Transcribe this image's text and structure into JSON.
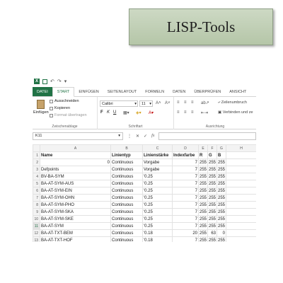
{
  "banner": {
    "title": "LISP-Tools"
  },
  "qat": {
    "app_icon": "X",
    "icons": [
      "excel-logo-icon",
      "save-icon",
      "undo-icon",
      "redo-icon",
      "customize-icon"
    ],
    "undo_glyph": "↶",
    "redo_glyph": "↷",
    "more_glyph": "▾"
  },
  "tabs": [
    "DATEI",
    "START",
    "EINFÜGEN",
    "SEITENLAYOUT",
    "FORMELN",
    "DATEN",
    "ÜBERPRÜFEN",
    "ANSICHT"
  ],
  "active_tab": "START",
  "ribbon": {
    "clipboard": {
      "paste_label": "Einfügen",
      "cut_label": "Ausschneiden",
      "copy_label": "Kopieren",
      "format_painter_label": "Format übertragen",
      "group_label": "Zwischenablage"
    },
    "font": {
      "font_name": "Calibri",
      "font_size": "11",
      "bold": "F",
      "italic": "K",
      "underline": "U",
      "group_label": "Schriftart"
    },
    "alignment": {
      "wrap_text_label": "Zeilenumbruch",
      "merge_label": "Verbinden und ze",
      "group_label": "Ausrichtung"
    }
  },
  "formula_bar": {
    "name_box": "K11",
    "value": ""
  },
  "sheet": {
    "columns": [
      "A",
      "B",
      "C",
      "D",
      "E",
      "F",
      "G",
      "H"
    ],
    "selected_row": 11,
    "rows": [
      {
        "n": "1",
        "cells": [
          "Name",
          "Linientyp",
          "Linienstärke",
          "Indexfarbe",
          "R",
          "G",
          "B",
          ""
        ]
      },
      {
        "n": "2",
        "cells": [
          "0",
          "Continuous",
          "Vorgabe",
          "7",
          "255",
          "255",
          "255",
          ""
        ]
      },
      {
        "n": "3",
        "cells": [
          "Defpoints",
          "Continuous",
          "Vorgabe",
          "7",
          "255",
          "255",
          "255",
          ""
        ]
      },
      {
        "n": "4",
        "cells": [
          "BV-BA-SYM",
          "Continuous",
          "'0.25",
          "7",
          "255",
          "255",
          "255",
          ""
        ]
      },
      {
        "n": "5",
        "cells": [
          "BA-AT-SYM-AUS",
          "Continuous",
          "'0.25",
          "7",
          "255",
          "255",
          "255",
          ""
        ]
      },
      {
        "n": "6",
        "cells": [
          "BA-AT-SYM-EIN",
          "Continuous",
          "'0.25",
          "7",
          "255",
          "255",
          "255",
          ""
        ]
      },
      {
        "n": "7",
        "cells": [
          "BA-AT-SYM-OHN",
          "Continuous",
          "'0.25",
          "7",
          "255",
          "255",
          "255",
          ""
        ]
      },
      {
        "n": "8",
        "cells": [
          "BA-AT-SYM-PHO",
          "Continuous",
          "'0.25",
          "7",
          "255",
          "255",
          "255",
          ""
        ]
      },
      {
        "n": "9",
        "cells": [
          "BA-AT-SYM-SKA",
          "Continuous",
          "'0.25",
          "7",
          "255",
          "255",
          "255",
          ""
        ]
      },
      {
        "n": "10",
        "cells": [
          "BA-AT-SYM-SKE",
          "Continuous",
          "'0.25",
          "7",
          "255",
          "255",
          "255",
          ""
        ]
      },
      {
        "n": "11",
        "cells": [
          "BA-AT-SYM",
          "Continuous",
          "'0.25",
          "7",
          "255",
          "255",
          "255",
          ""
        ]
      },
      {
        "n": "12",
        "cells": [
          "BA-AT-TXT-BEM",
          "Continuous",
          "'0.18",
          "20",
          "255",
          "63",
          "0",
          ""
        ]
      },
      {
        "n": "13",
        "cells": [
          "BA-AT-TXT-HOF",
          "Continuous",
          "'0.18",
          "7",
          "255",
          "255",
          "255",
          ""
        ]
      }
    ]
  }
}
